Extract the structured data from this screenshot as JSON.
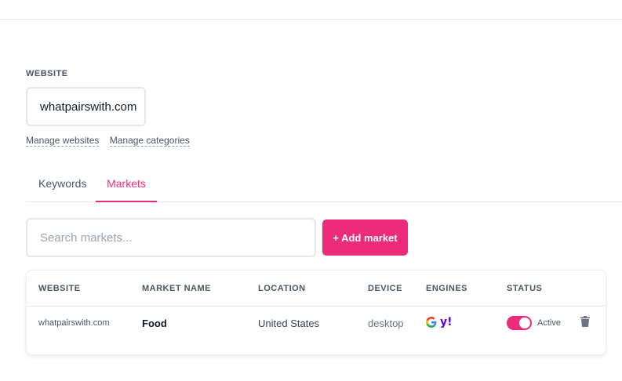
{
  "website": {
    "label": "WEBSITE",
    "selected": "whatpairswith.com",
    "links": {
      "manage_websites": "Manage websites",
      "manage_categories": "Manage categories"
    }
  },
  "tabs": [
    {
      "label": "Keywords",
      "active": false
    },
    {
      "label": "Markets",
      "active": true
    }
  ],
  "toolbar": {
    "search_placeholder": "Search markets...",
    "add_label": "+ Add market"
  },
  "table": {
    "headers": [
      "WEBSITE",
      "MARKET NAME",
      "LOCATION",
      "DEVICE",
      "ENGINES",
      "STATUS"
    ],
    "rows": [
      {
        "website": "whatpairswith.com",
        "market_name": "Food",
        "location": "United States",
        "device": "desktop",
        "engines": [
          "google-icon",
          "yahoo-icon"
        ],
        "yahoo_glyph": "y!",
        "status": "Active"
      }
    ]
  },
  "colors": {
    "accent": "#ec2b7a",
    "yahoo": "#6001d2"
  }
}
